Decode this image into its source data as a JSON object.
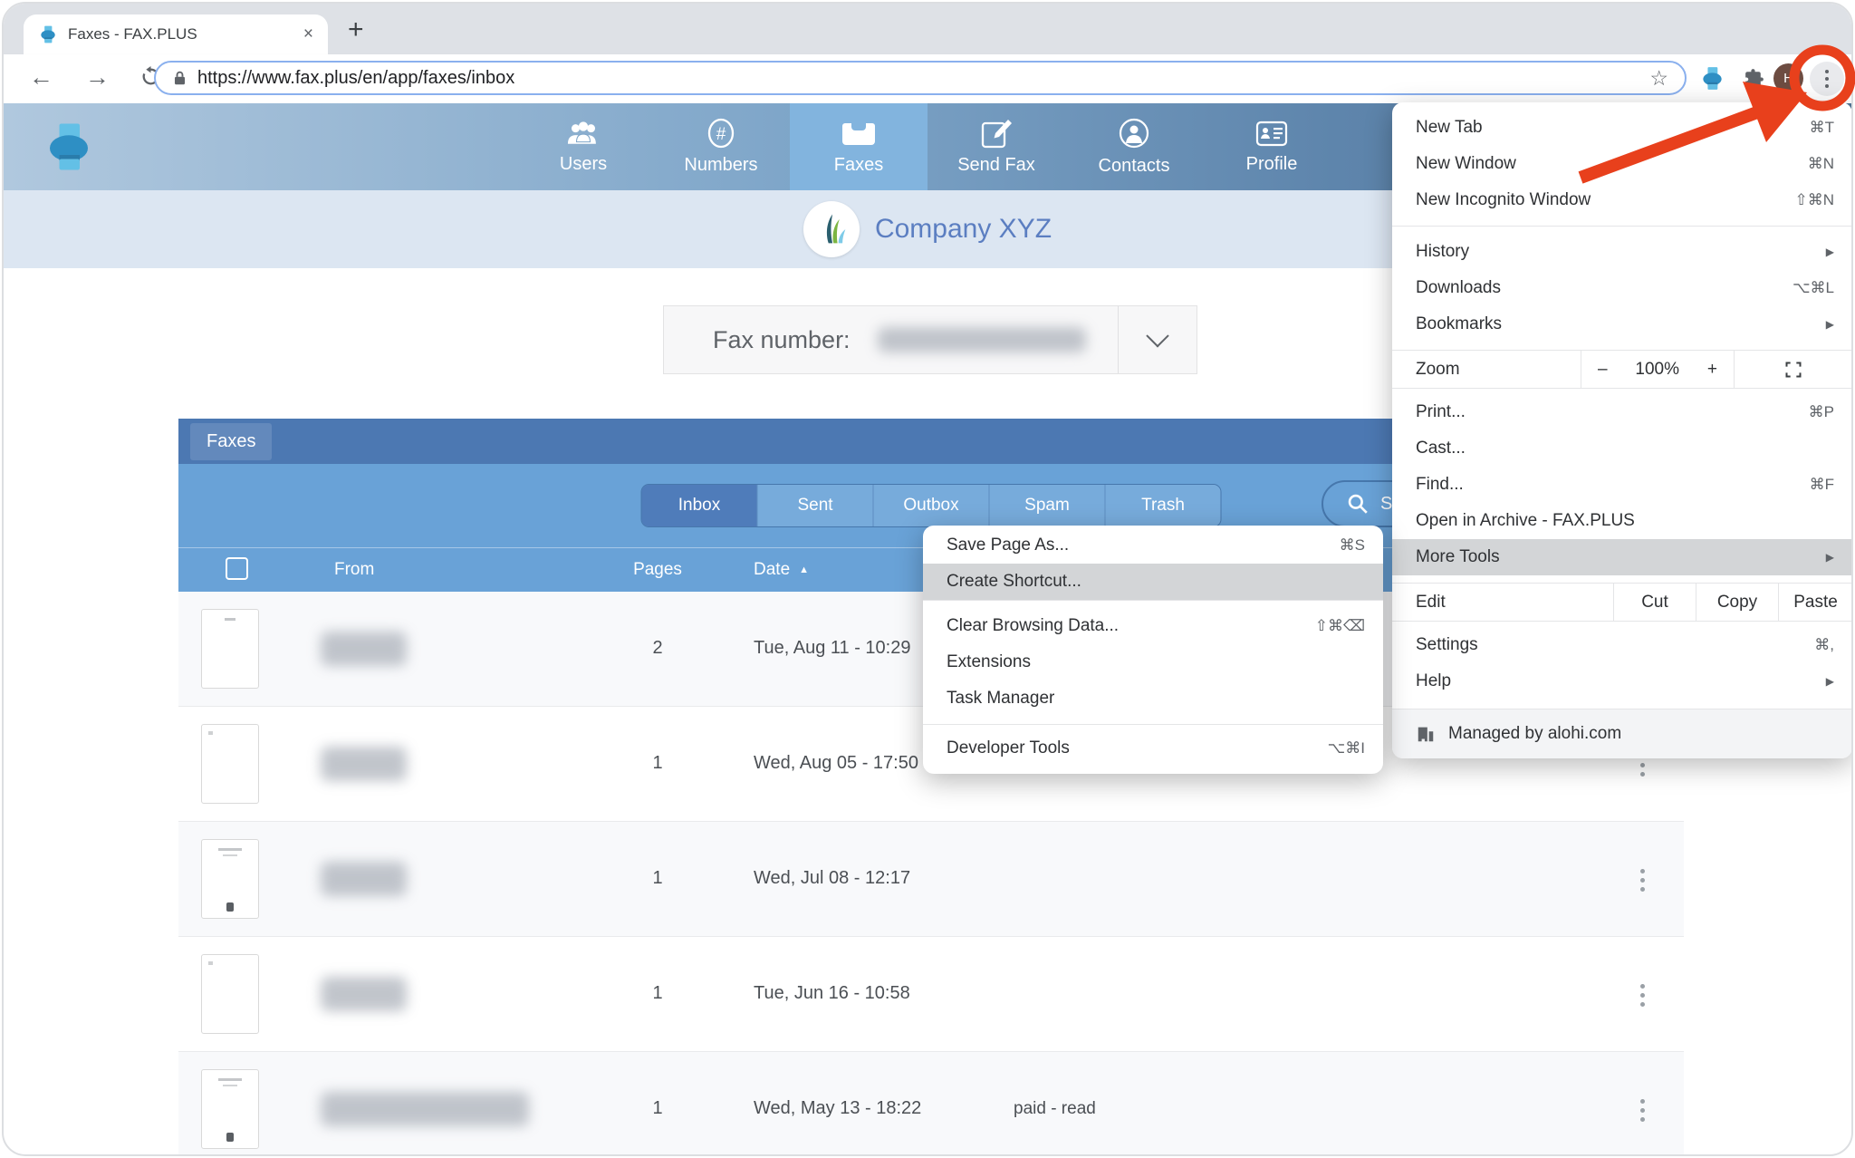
{
  "browser": {
    "tab_title": "Faxes - FAX.PLUS",
    "tab_close": "×",
    "new_tab": "+",
    "back": "←",
    "forward": "→",
    "url": "https://www.fax.plus/en/app/faxes/inbox",
    "star": "☆",
    "avatar_initial": "H"
  },
  "nav": {
    "items": [
      {
        "label": "Users"
      },
      {
        "label": "Numbers"
      },
      {
        "label": "Faxes"
      },
      {
        "label": "Send Fax"
      },
      {
        "label": "Contacts"
      },
      {
        "label": "Profile"
      }
    ]
  },
  "company": {
    "name": "Company XYZ"
  },
  "fax_selector": {
    "label": "Fax number:"
  },
  "panel": {
    "title": "Faxes",
    "tabs": [
      {
        "label": "Inbox"
      },
      {
        "label": "Sent"
      },
      {
        "label": "Outbox"
      },
      {
        "label": "Spam"
      },
      {
        "label": "Trash"
      }
    ],
    "search_text": "S",
    "columns": {
      "from": "From",
      "pages": "Pages",
      "date": "Date",
      "sort": "▲"
    },
    "rows": [
      {
        "pages": "2",
        "date": "Tue, Aug 11 - 10:29",
        "status": ""
      },
      {
        "pages": "1",
        "date": "Wed, Aug 05 - 17:50",
        "status": ""
      },
      {
        "pages": "1",
        "date": "Wed, Jul 08 - 12:17",
        "status": ""
      },
      {
        "pages": "1",
        "date": "Tue, Jun 16 - 10:58",
        "status": ""
      },
      {
        "pages": "1",
        "date": "Wed, May 13 - 18:22",
        "status": "paid - read"
      }
    ]
  },
  "menu": {
    "new_tab": {
      "label": "New Tab",
      "shortcut": "⌘T"
    },
    "new_window": {
      "label": "New Window",
      "shortcut": "⌘N"
    },
    "new_incognito": {
      "label": "New Incognito Window",
      "shortcut": "⇧⌘N"
    },
    "history": {
      "label": "History"
    },
    "downloads": {
      "label": "Downloads",
      "shortcut": "⌥⌘L"
    },
    "bookmarks": {
      "label": "Bookmarks"
    },
    "zoom": {
      "label": "Zoom",
      "minus": "–",
      "value": "100%",
      "plus": "+"
    },
    "print": {
      "label": "Print...",
      "shortcut": "⌘P"
    },
    "cast": {
      "label": "Cast..."
    },
    "find": {
      "label": "Find...",
      "shortcut": "⌘F"
    },
    "open_archive": {
      "label": "Open in Archive - FAX.PLUS"
    },
    "more_tools": {
      "label": "More Tools"
    },
    "edit": {
      "label": "Edit",
      "cut": "Cut",
      "copy": "Copy",
      "paste": "Paste"
    },
    "settings": {
      "label": "Settings",
      "shortcut": "⌘,"
    },
    "help": {
      "label": "Help"
    },
    "managed": {
      "label": "Managed by alohi.com"
    },
    "submenu_arrow": "▶"
  },
  "more_tools": {
    "save_page": {
      "label": "Save Page As...",
      "shortcut": "⌘S"
    },
    "create_shortcut": {
      "label": "Create Shortcut..."
    },
    "clear_data": {
      "label": "Clear Browsing Data...",
      "shortcut": "⇧⌘⌫"
    },
    "extensions": {
      "label": "Extensions"
    },
    "task_manager": {
      "label": "Task Manager"
    },
    "dev_tools": {
      "label": "Developer Tools",
      "shortcut": "⌥⌘I"
    }
  },
  "colors": {
    "annotation_red": "#e8401c",
    "nav_active_blue": "#82b4de",
    "panel_header_blue": "#4c78b2",
    "panel_body_blue": "#69a2d7",
    "company_text_blue": "#5b7ec1"
  }
}
